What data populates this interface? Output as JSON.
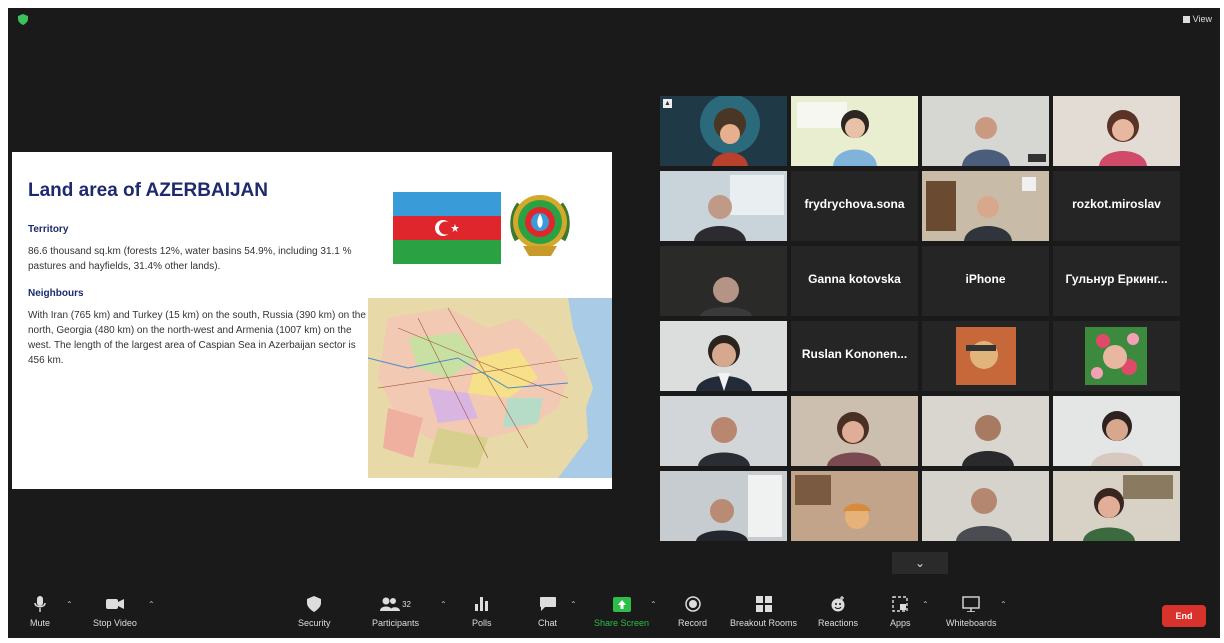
{
  "window": {
    "view_label": "View"
  },
  "slide": {
    "title": "Land area of AZERBAIJAN",
    "territory_heading": "Territory",
    "territory_text": "86.6 thousand sq.km (forests 12%, water basins 54.9%, including 31.1 % pastures and hayfields, 31.4% other lands).",
    "neighbours_heading": "Neighbours",
    "neighbours_text": "With Iran (765 km) and Turkey (15 km) on the south, Russia (390 km) on the north, Georgia (480 km) on the north-west and Armenia (1007 km) on the west. The length of the largest area of Caspian Sea in Azerbaijan sector is 456 km."
  },
  "gallery": {
    "name_tiles": [
      "frydrychova.sona",
      "rozkot.miroslav",
      "Ganna kotovska",
      "iPhone",
      "Гульнур Еркинг...",
      "Ruslan Kononen..."
    ]
  },
  "toolbar": {
    "mute": "Mute",
    "stop_video": "Stop Video",
    "security": "Security",
    "participants": "Participants",
    "participants_count": "32",
    "polls": "Polls",
    "chat": "Chat",
    "share_screen": "Share Screen",
    "record": "Record",
    "breakout_rooms": "Breakout Rooms",
    "reactions": "Reactions",
    "apps": "Apps",
    "whiteboards": "Whiteboards",
    "end": "End"
  },
  "colors": {
    "share_green": "#2dbe4a",
    "end_red": "#d9312b",
    "active_border": "#d8e86b"
  }
}
